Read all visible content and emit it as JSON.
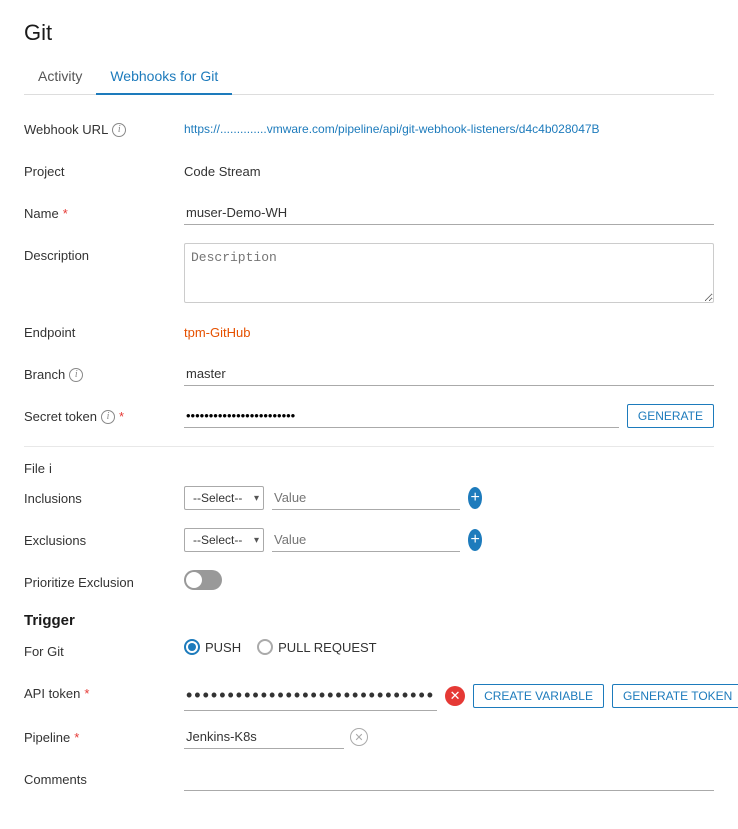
{
  "page": {
    "title": "Git"
  },
  "tabs": [
    {
      "id": "activity",
      "label": "Activity",
      "active": false
    },
    {
      "id": "webhooks",
      "label": "Webhooks for Git",
      "active": true
    }
  ],
  "form": {
    "webhook_url_label": "Webhook URL",
    "webhook_url_value": "https://..............vmware.com/pipeline/api/git-webhook-listeners/d4c4b028047B",
    "project_label": "Project",
    "project_value": "Code Stream",
    "name_label": "Name",
    "name_required": "*",
    "name_value": "muser-Demo-WH",
    "description_label": "Description",
    "description_placeholder": "Description",
    "endpoint_label": "Endpoint",
    "endpoint_value": "tpm-GitHub",
    "branch_label": "Branch",
    "branch_value": "master",
    "secret_token_label": "Secret token",
    "secret_token_required": "*",
    "secret_token_value": "••••••••••••••••••••••••",
    "generate_btn": "GENERATE",
    "file_label": "File",
    "inclusions_label": "Inclusions",
    "exclusions_label": "Exclusions",
    "select_placeholder": "--Select--",
    "value_placeholder": "Value",
    "prioritize_label": "Prioritize Exclusion",
    "trigger_title": "Trigger",
    "for_git_label": "For Git",
    "push_label": "PUSH",
    "pull_request_label": "PULL REQUEST",
    "api_token_label": "API token",
    "api_token_required": "*",
    "api_token_dots": "••••••••••••••••••••••••••••••",
    "create_variable_btn": "CREATE VARIABLE",
    "generate_token_btn": "GENERATE TOKEN",
    "pipeline_label": "Pipeline",
    "pipeline_required": "*",
    "pipeline_value": "Jenkins-K8s",
    "comments_label": "Comments"
  }
}
